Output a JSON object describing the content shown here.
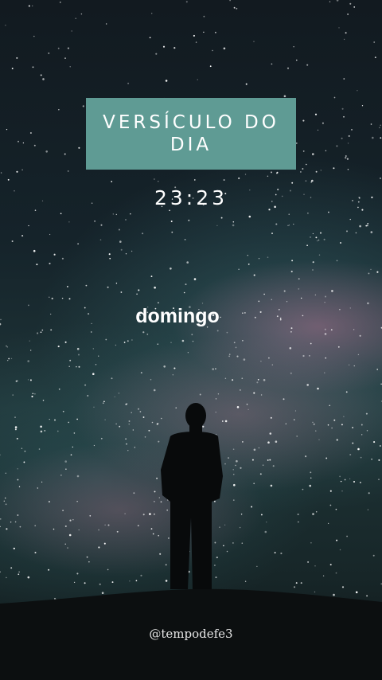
{
  "story": {
    "title": "VERSÍCULO DO DIA",
    "time": "23:23",
    "weekday": "domingo",
    "handle": "@tempodefe3",
    "accent_color": "#5f9b94",
    "background": "starry-night-sky-with-milky-way",
    "figure": "person-silhouette-icon"
  }
}
